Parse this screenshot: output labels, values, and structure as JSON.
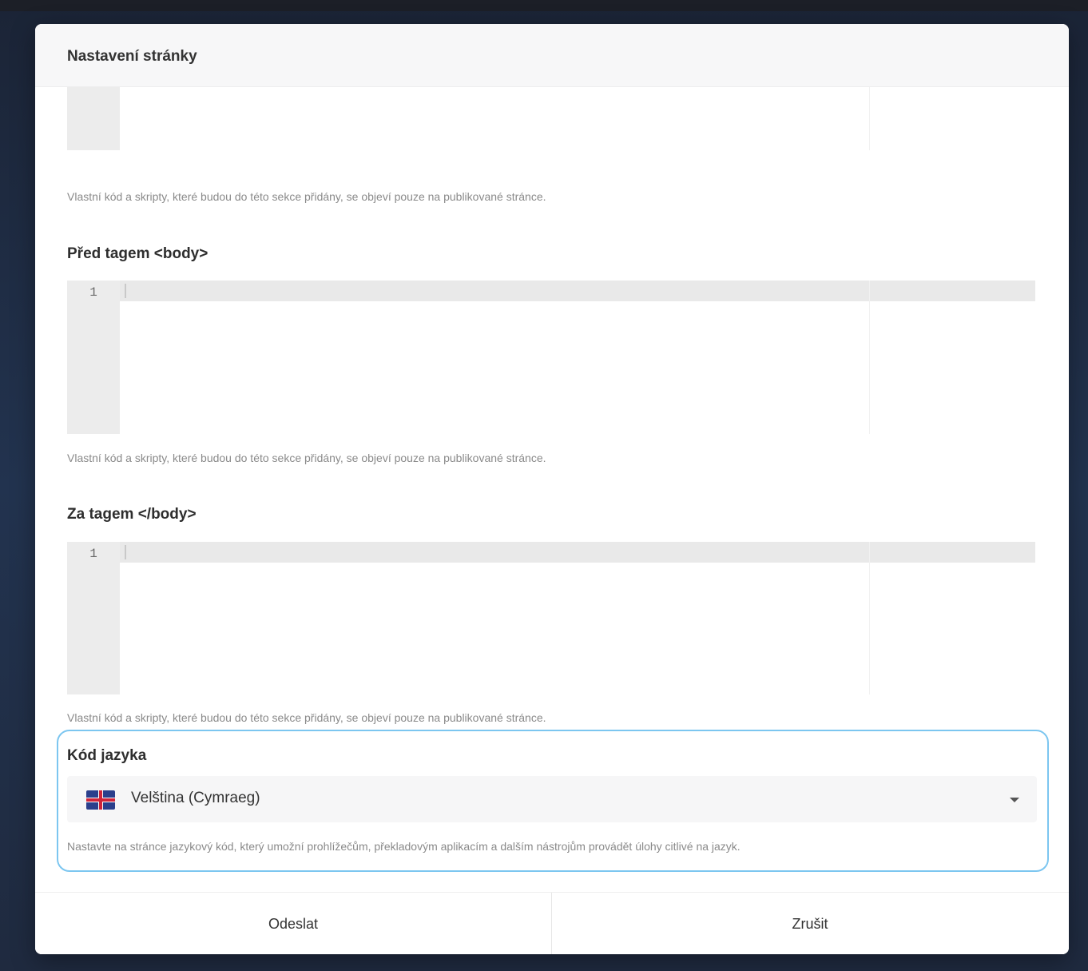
{
  "modal": {
    "title": "Nastavení stránky"
  },
  "sections": {
    "head": {
      "hint": "Vlastní kód a skripty, které budou do této sekce přidány, se objeví pouze na publikované stránce."
    },
    "before_body": {
      "label": "Před tagem <body>",
      "line_number": "1",
      "hint": "Vlastní kód a skripty, které budou do této sekce přidány, se objeví pouze na publikované stránce."
    },
    "after_body": {
      "label": "Za tagem </body>",
      "line_number": "1",
      "hint": "Vlastní kód a skripty, které budou do této sekce přidány, se objeví pouze na publikované stránce."
    }
  },
  "language": {
    "label": "Kód jazyka",
    "selected": "Velština (Cymraeg)",
    "flag_icon": "flag-icon",
    "hint": "Nastavte na stránce jazykový kód, který umožní prohlížečům, překladovým aplikacím a dalším nástrojům provádět úlohy citlivé na jazyk."
  },
  "footer": {
    "submit_label": "Odeslat",
    "cancel_label": "Zrušit"
  },
  "colors": {
    "focus_border": "#7cc6f0",
    "gutter": "#ececec"
  }
}
